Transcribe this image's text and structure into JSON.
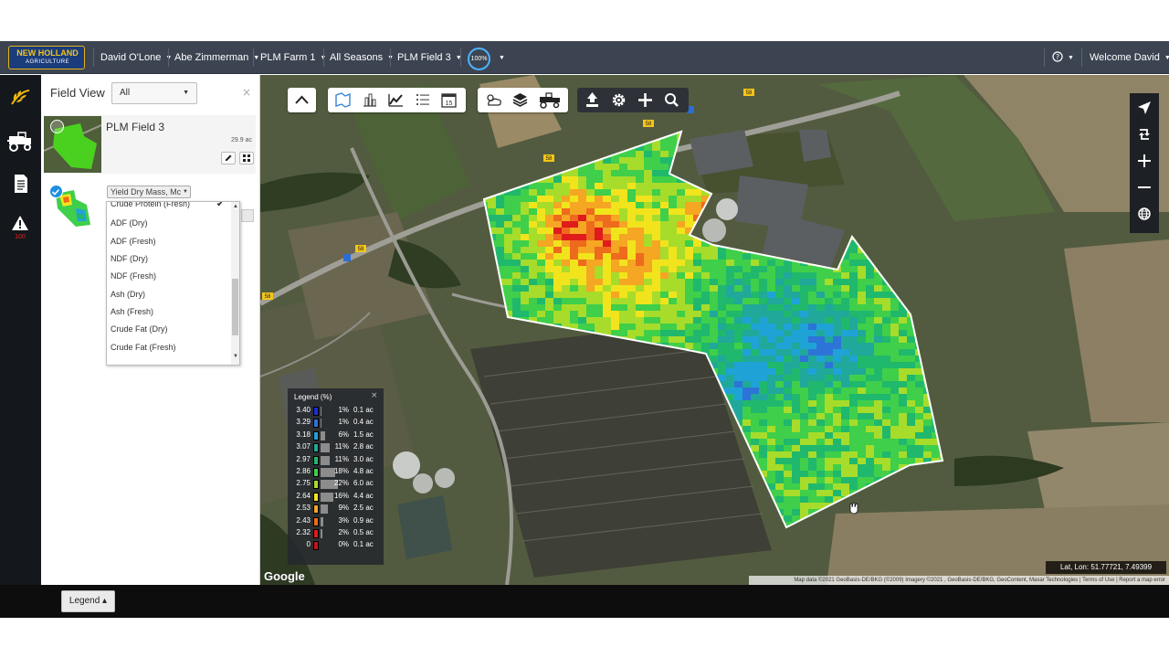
{
  "topbar": {
    "logo": {
      "brand": "NEW HOLLAND",
      "sub": "AGRICULTURE"
    },
    "nav": [
      {
        "label": "David O'Lone"
      },
      {
        "label": "Abe Zimmerman"
      },
      {
        "label": "PLM Farm 1"
      },
      {
        "label": "All Seasons"
      },
      {
        "label": "PLM Field 3"
      }
    ],
    "zoom_badge": "100%",
    "help_icon": "help-circle-icon",
    "welcome": "Welcome David"
  },
  "rail": {
    "items": [
      {
        "icon": "wheat-icon",
        "active": true
      },
      {
        "icon": "harvester-icon"
      },
      {
        "icon": "document-icon"
      },
      {
        "icon": "alert-triangle-icon",
        "badge": "100"
      }
    ]
  },
  "panel": {
    "title": "Field View",
    "filter": "All",
    "close": "×",
    "field": {
      "name": "PLM Field 3",
      "area": "29.9 ac"
    },
    "layer_select": "Yield Dry Mass, Mc",
    "dropdown": {
      "items": [
        {
          "label": "Crude Protein (Fresh)",
          "checked": true
        },
        {
          "label": "ADF (Dry)"
        },
        {
          "label": "ADF (Fresh)"
        },
        {
          "label": "NDF (Dry)"
        },
        {
          "label": "NDF (Fresh)"
        },
        {
          "label": "Ash (Dry)"
        },
        {
          "label": "Ash (Fresh)"
        },
        {
          "label": "Crude Fat (Dry)"
        },
        {
          "label": "Crude Fat (Fresh)"
        }
      ],
      "check_mark": "✔"
    }
  },
  "map": {
    "toolbar_icons": [
      "collapse-up-icon",
      "field-boundary-icon",
      "bar-chart-icon",
      "line-chart-icon",
      "list-icon",
      "calendar-icon",
      "weather-icon",
      "layers-icon",
      "harvester-icon",
      "upload-icon",
      "settings-icon",
      "plus-icon",
      "search-icon"
    ],
    "calendar_day": "15",
    "right_tools": [
      "navigate-icon",
      "rotate-icon",
      "zoom-in-icon",
      "zoom-out-icon",
      "globe-icon"
    ],
    "road_signs": [
      "58",
      "58",
      "58",
      "58",
      "58"
    ],
    "google": "Google",
    "latlon": "Lat, Lon: 51.77721, 7.49399",
    "attribution": "Map data ©2021 GeoBasis-DE/BKG (©2009) Imagery ©2021 , GeoBasis-DE/BKG, GeoContent, Maxar Technologies | Terms of Use | Report a map error",
    "heat_colors": [
      "#e01b1b",
      "#ee6a1c",
      "#f5a623",
      "#f2e41c",
      "#a7dc2b",
      "#3fcf4a",
      "#20b86c",
      "#20a89a",
      "#1fa3d6",
      "#2d74d8",
      "#1c2fd1"
    ]
  },
  "legend": {
    "title": "Legend (%)",
    "close": "×",
    "rows": [
      {
        "value": "3.40",
        "color": "#1c2fd1",
        "pct": "1%",
        "area": "0.1 ac",
        "share": 1
      },
      {
        "value": "3.29",
        "color": "#2d74d8",
        "pct": "1%",
        "area": "0.4 ac",
        "share": 1
      },
      {
        "value": "3.18",
        "color": "#1fa3d6",
        "pct": "6%",
        "area": "1.5 ac",
        "share": 6
      },
      {
        "value": "3.07",
        "color": "#20a89a",
        "pct": "11%",
        "area": "2.8 ac",
        "share": 11
      },
      {
        "value": "2.97",
        "color": "#20b86c",
        "pct": "11%",
        "area": "3.0 ac",
        "share": 11
      },
      {
        "value": "2.86",
        "color": "#3fcf4a",
        "pct": "18%",
        "area": "4.8 ac",
        "share": 18
      },
      {
        "value": "2.75",
        "color": "#a7dc2b",
        "pct": "22%",
        "area": "6.0 ac",
        "share": 22
      },
      {
        "value": "2.64",
        "color": "#f2e41c",
        "pct": "16%",
        "area": "4.4 ac",
        "share": 16
      },
      {
        "value": "2.53",
        "color": "#f5a623",
        "pct": "9%",
        "area": "2.5 ac",
        "share": 9
      },
      {
        "value": "2.43",
        "color": "#ee6a1c",
        "pct": "3%",
        "area": "0.9 ac",
        "share": 3
      },
      {
        "value": "2.32",
        "color": "#e01b1b",
        "pct": "2%",
        "area": "0.5 ac",
        "share": 2
      },
      {
        "value": "0",
        "color": "#c4101a",
        "pct": "0%",
        "area": "0.1 ac",
        "share": 0
      }
    ]
  },
  "bottombar": {
    "legend_button": "Legend ▴"
  },
  "colors": {
    "accent": "#4db3ff",
    "topbar": "#3c4452",
    "rail": "#14171c"
  }
}
